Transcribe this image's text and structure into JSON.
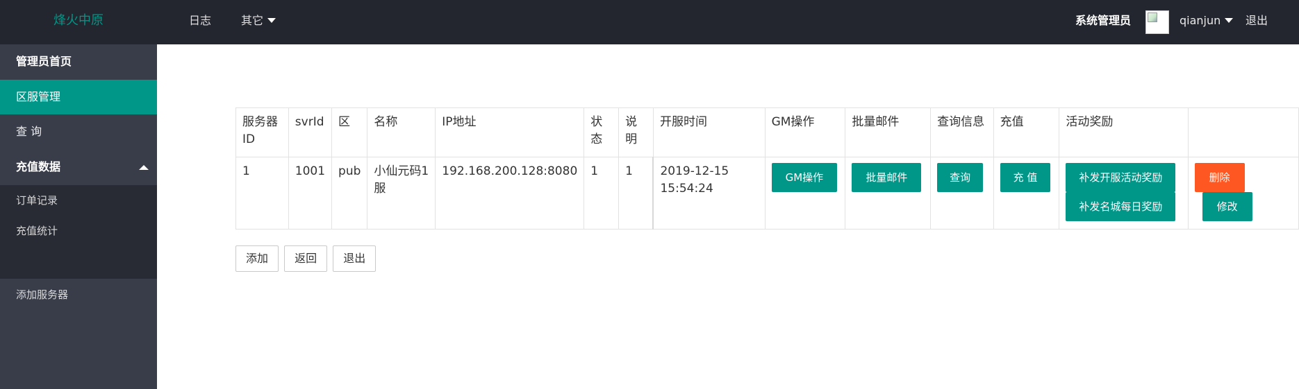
{
  "header": {
    "logo": "烽火中原",
    "nav_log": "日志",
    "nav_other": "其它",
    "role": "系统管理员",
    "username": "qianjun",
    "logout": "退出"
  },
  "sidebar": {
    "items": [
      {
        "label": "管理员首页"
      },
      {
        "label": "区服管理"
      },
      {
        "label": "查 询"
      },
      {
        "label": "充值数据"
      }
    ],
    "children": [
      {
        "label": "订单记录"
      },
      {
        "label": "充值统计"
      }
    ],
    "add_server": "添加服务器"
  },
  "table": {
    "headers": [
      "服务器ID",
      "svrId",
      "区",
      "名称",
      "IP地址",
      "状态",
      "说明",
      "开服时间",
      "GM操作",
      "批量邮件",
      "查询信息",
      "充值",
      "活动奖励",
      ""
    ],
    "row": {
      "server_id": "1",
      "svr_id": "1001",
      "zone": "pub",
      "name": "小仙元码1服",
      "ip": "192.168.200.128:8080",
      "status": "1",
      "note": "1",
      "open_time": "2019-12-15 15:54:24",
      "gm_btn": "GM操作",
      "mail_btn": "批量邮件",
      "query_btn": "查询",
      "recharge_btn": "充 值",
      "reward_btn1": "补发开服活动奖励",
      "reward_btn2": "补发名城每日奖励",
      "delete_btn": "删除",
      "edit_btn": "修改"
    }
  },
  "actions": {
    "add": "添加",
    "back": "返回",
    "exit": "退出"
  },
  "colors": {
    "primary": "#009688",
    "danger": "#ff5722",
    "header_bg": "#23262e",
    "sidebar_bg": "#393d49"
  }
}
